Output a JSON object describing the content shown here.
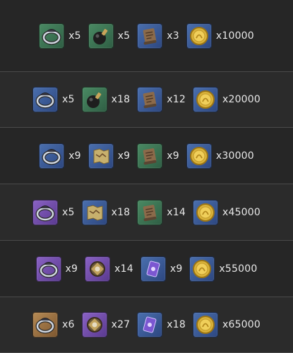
{
  "colors": {
    "green": "#4a8a63",
    "blue": "#4a6fae",
    "purple": "#8a62c4",
    "gold": "#b68a54",
    "background": "#262626"
  },
  "rows": [
    {
      "items": [
        {
          "icon": "ring-icon",
          "rarity": "green",
          "qty": "x5"
        },
        {
          "icon": "bomb-icon",
          "rarity": "green",
          "qty": "x5"
        },
        {
          "icon": "scroll-icon",
          "rarity": "blue",
          "qty": "x3"
        },
        {
          "icon": "gold-coin-icon",
          "rarity": "blue",
          "qty": "x10000"
        }
      ]
    },
    {
      "items": [
        {
          "icon": "ring-icon",
          "rarity": "blue",
          "qty": "x5"
        },
        {
          "icon": "bomb-icon",
          "rarity": "green",
          "qty": "x18"
        },
        {
          "icon": "scroll-icon",
          "rarity": "blue",
          "qty": "x12"
        },
        {
          "icon": "gold-coin-icon",
          "rarity": "blue",
          "qty": "x20000"
        }
      ]
    },
    {
      "items": [
        {
          "icon": "ring-icon",
          "rarity": "blue",
          "qty": "x9"
        },
        {
          "icon": "map-icon",
          "rarity": "blue",
          "qty": "x9"
        },
        {
          "icon": "scroll-icon",
          "rarity": "green",
          "qty": "x9"
        },
        {
          "icon": "gold-coin-icon",
          "rarity": "blue",
          "qty": "x30000"
        }
      ]
    },
    {
      "items": [
        {
          "icon": "ring-icon",
          "rarity": "purple",
          "qty": "x5"
        },
        {
          "icon": "map-icon",
          "rarity": "blue",
          "qty": "x18"
        },
        {
          "icon": "scroll-icon",
          "rarity": "green",
          "qty": "x14"
        },
        {
          "icon": "gold-coin-icon",
          "rarity": "blue",
          "qty": "x45000"
        }
      ]
    },
    {
      "items": [
        {
          "icon": "ring-icon",
          "rarity": "purple",
          "qty": "x9"
        },
        {
          "icon": "gem-core-icon",
          "rarity": "purple",
          "qty": "x14"
        },
        {
          "icon": "purple-scroll-icon",
          "rarity": "blue",
          "qty": "x9"
        },
        {
          "icon": "gold-coin-icon",
          "rarity": "blue",
          "qty": "x55000"
        }
      ]
    },
    {
      "items": [
        {
          "icon": "ring-icon",
          "rarity": "gold",
          "qty": "x6"
        },
        {
          "icon": "gem-core-icon",
          "rarity": "purple",
          "qty": "x27"
        },
        {
          "icon": "purple-scroll-icon",
          "rarity": "blue",
          "qty": "x18"
        },
        {
          "icon": "gold-coin-icon",
          "rarity": "blue",
          "qty": "x65000"
        }
      ]
    }
  ]
}
